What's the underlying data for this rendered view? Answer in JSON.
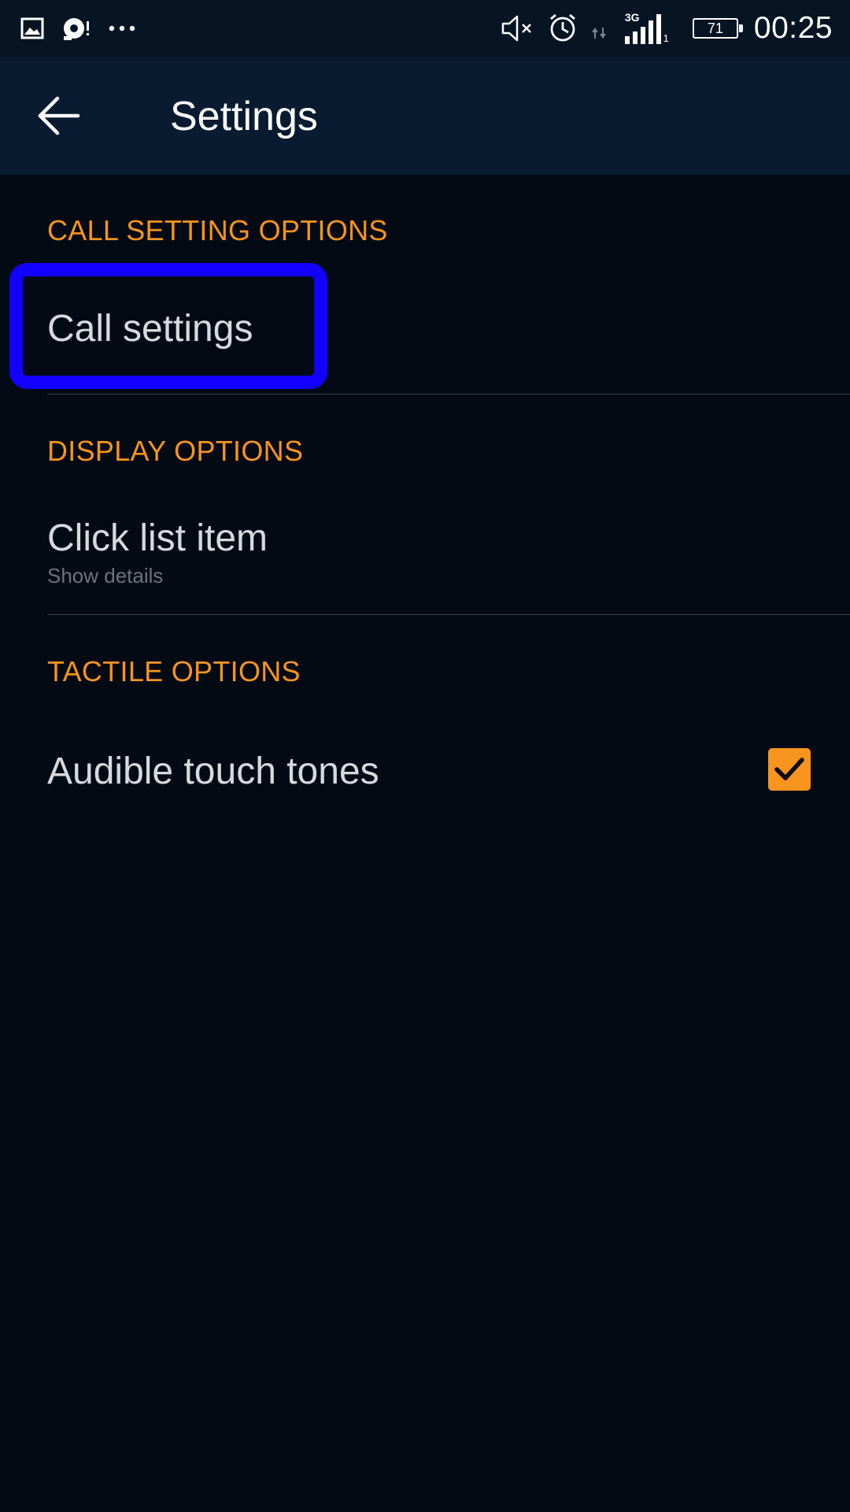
{
  "status_bar": {
    "time": "00:25",
    "battery_level": "71",
    "network_type": "3G",
    "sim_slot": "1",
    "left_icons": [
      "gallery-icon",
      "sync-alert-icon",
      "more-dots-icon"
    ],
    "right_icons": [
      "mute-icon",
      "alarm-icon",
      "data-arrows-icon",
      "signal-icon",
      "battery-icon"
    ]
  },
  "app_bar": {
    "title": "Settings"
  },
  "sections": [
    {
      "header": "CALL SETTING OPTIONS",
      "items": [
        {
          "title": "Call settings",
          "highlighted": true
        }
      ]
    },
    {
      "header": "DISPLAY OPTIONS",
      "items": [
        {
          "title": "Click list item",
          "summary": "Show details"
        }
      ]
    },
    {
      "header": "TACTILE OPTIONS",
      "items": [
        {
          "title": "Audible touch tones",
          "checked": true
        }
      ]
    }
  ],
  "colors": {
    "accent": "#f7941d",
    "background": "#030a14",
    "app_bar": "#081b30",
    "status_bar": "#061423",
    "highlight": "#1200ff",
    "text_primary": "#d6d9de",
    "text_secondary": "#6b727c"
  }
}
